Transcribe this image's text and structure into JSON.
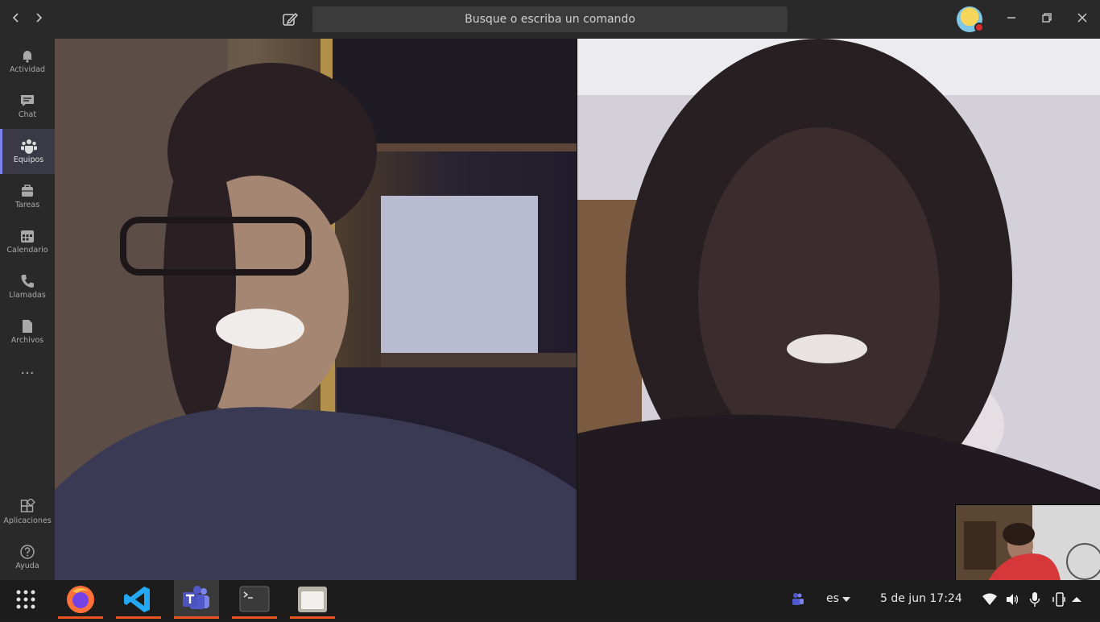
{
  "search": {
    "placeholder": "Busque o escriba un comando"
  },
  "rail": {
    "items": [
      {
        "label": "Actividad",
        "icon": "bell-icon"
      },
      {
        "label": "Chat",
        "icon": "chat-icon"
      },
      {
        "label": "Equipos",
        "icon": "teams-icon",
        "active": true
      },
      {
        "label": "Tareas",
        "icon": "briefcase-icon"
      },
      {
        "label": "Calendario",
        "icon": "calendar-icon"
      },
      {
        "label": "Llamadas",
        "icon": "phone-icon"
      },
      {
        "label": "Archivos",
        "icon": "file-icon"
      }
    ],
    "more": "...",
    "bottom": [
      {
        "label": "Aplicaciones",
        "icon": "apps-icon"
      },
      {
        "label": "Ayuda",
        "icon": "help-icon"
      }
    ]
  },
  "taskbar": {
    "apps": [
      "firefox-icon",
      "vscode-icon",
      "teams-icon",
      "terminal-icon",
      "files-icon"
    ],
    "language": "es",
    "clock": "5 de jun  17:24"
  },
  "colors": {
    "accent": "#7b83eb",
    "ubuntu_orange": "#e95420"
  }
}
